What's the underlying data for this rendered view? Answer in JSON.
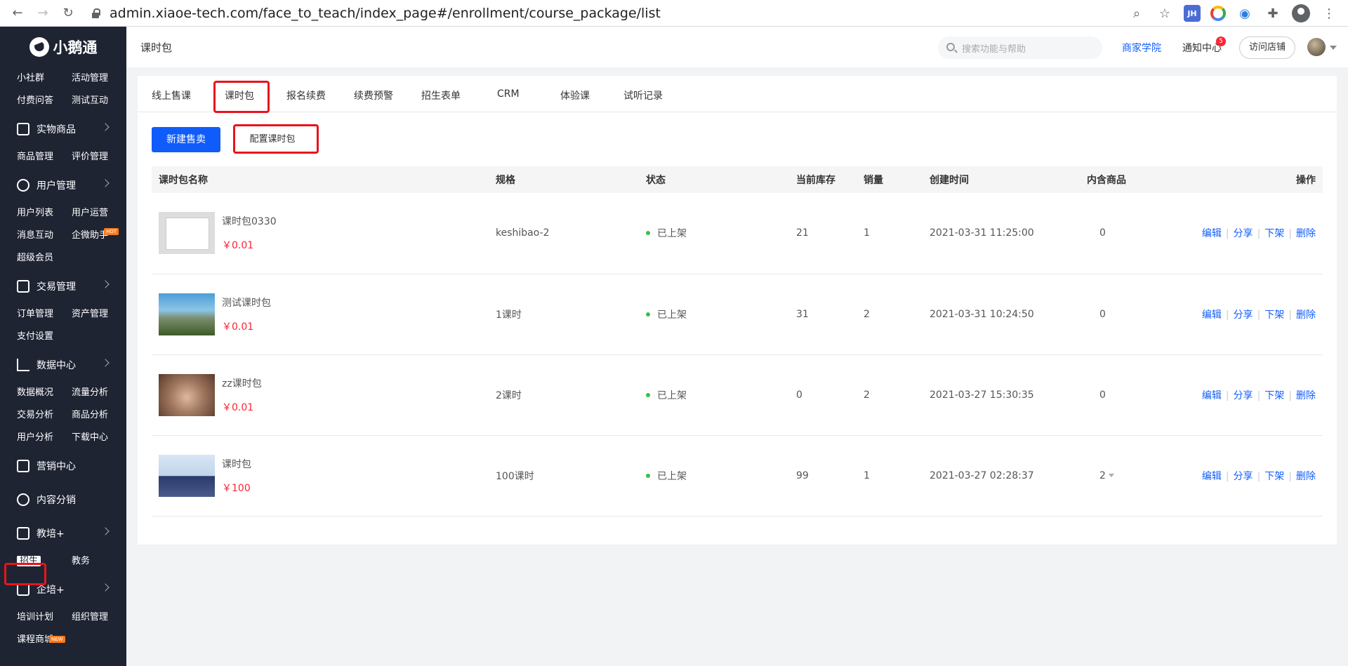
{
  "browser": {
    "url": "admin.xiaoe-tech.com/face_to_teach/index_page#/enrollment/course_package/list",
    "ext_jh": "JH"
  },
  "sidebar": {
    "logo": "小鹅通",
    "groups": [
      {
        "label": "",
        "subs": [
          "小社群",
          "活动管理",
          "付费问答",
          "测试互动"
        ]
      },
      {
        "label": "实物商品",
        "subs": [
          "商品管理",
          "评价管理"
        ]
      },
      {
        "label": "用户管理",
        "subs": [
          "用户列表",
          "用户运营",
          "消息互动",
          "企微助手",
          "超级会员"
        ]
      },
      {
        "label": "交易管理",
        "subs": [
          "订单管理",
          "资产管理",
          "支付设置"
        ]
      },
      {
        "label": "数据中心",
        "subs": [
          "数据概况",
          "流量分析",
          "交易分析",
          "商品分析",
          "用户分析",
          "下载中心"
        ]
      },
      {
        "label": "营销中心",
        "subs": []
      },
      {
        "label": "内容分销",
        "subs": []
      },
      {
        "label": "教培+",
        "subs": [
          "招生",
          "教务"
        ]
      },
      {
        "label": "企培+",
        "subs": [
          "培训计划",
          "组织管理",
          "课程商城"
        ]
      }
    ],
    "hot_badge": "HOT",
    "new_badge": "NEW"
  },
  "header": {
    "title": "课时包",
    "search_placeholder": "搜索功能与帮助",
    "academy": "商家学院",
    "notify": "通知中心",
    "notify_count": "5",
    "visit": "访问店铺"
  },
  "tabs": [
    "线上售课",
    "课时包",
    "报名续费",
    "续费预警",
    "招生表单",
    "CRM",
    "体验课",
    "试听记录"
  ],
  "buttons": {
    "new_sale": "新建售卖",
    "config": "配置课时包"
  },
  "table": {
    "headers": [
      "课时包名称",
      "规格",
      "状态",
      "当前库存",
      "销量",
      "创建时间",
      "内含商品",
      "操作"
    ],
    "rows": [
      {
        "name": "课时包0330",
        "price": "￥0.01",
        "spec": "keshibao-2",
        "status": "已上架",
        "stock": "21",
        "sales": "1",
        "created": "2021-03-31 11:25:00",
        "items": "0"
      },
      {
        "name": "测试课时包",
        "price": "￥0.01",
        "spec": "1课时",
        "status": "已上架",
        "stock": "31",
        "sales": "2",
        "created": "2021-03-31 10:24:50",
        "items": "0"
      },
      {
        "name": "zz课时包",
        "price": "￥0.01",
        "spec": "2课时",
        "status": "已上架",
        "stock": "0",
        "sales": "2",
        "created": "2021-03-27 15:30:35",
        "items": "0"
      },
      {
        "name": "课时包",
        "price": "￥100",
        "spec": "100课时",
        "status": "已上架",
        "stock": "99",
        "sales": "1",
        "created": "2021-03-27 02:28:37",
        "items": "2"
      }
    ],
    "actions": [
      "编辑",
      "分享",
      "下架",
      "删除"
    ]
  },
  "colors": {
    "primary": "#105cfb",
    "sidebar_bg": "#1f2433",
    "price": "#ff2233",
    "highlight": "#e8141b",
    "status_dot": "#35c14b"
  }
}
